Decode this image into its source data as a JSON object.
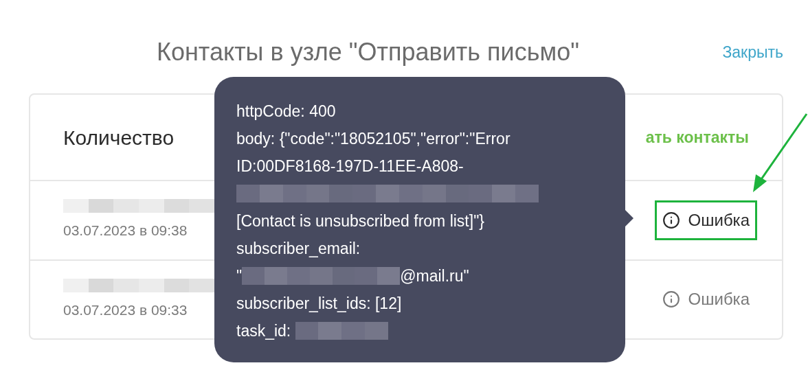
{
  "title": "Контакты в узле \"Отправить письмо\"",
  "close_link": "Закрыть",
  "table": {
    "header": "Количество",
    "action_link": "ать контакты",
    "rows": [
      {
        "name": {
          "kind": "redacted"
        },
        "date": "03.07.2023 в 09:38",
        "status": "Ошибка",
        "annotated": true
      },
      {
        "name": {
          "kind": "redacted"
        },
        "date": "03.07.2023 в 09:33",
        "status": "Ошибка",
        "annotated": false
      }
    ]
  },
  "tooltip": {
    "lines": [
      [
        {
          "kind": "text",
          "text": "httpCode: 400"
        }
      ],
      [
        {
          "kind": "text",
          "text": "body: {\"code\":\"18052105\",\"error\":\"Error"
        }
      ],
      [
        {
          "kind": "text",
          "text": "ID:00DF8168-197D-11EE-A808-"
        }
      ],
      [
        {
          "kind": "redacted"
        }
      ],
      [
        {
          "kind": "text",
          "text": "[Contact is unsubscribed from list]\"}"
        }
      ],
      [
        {
          "kind": "text",
          "text": "subscriber_email:"
        }
      ],
      [
        {
          "kind": "text",
          "text": "\""
        },
        {
          "kind": "redacted"
        },
        {
          "kind": "text",
          "text": "@mail.ru\""
        }
      ],
      [
        {
          "kind": "text",
          "text": "subscriber_list_ids: [12]"
        }
      ],
      [
        {
          "kind": "text",
          "text": "task_id: "
        },
        {
          "kind": "redacted"
        }
      ]
    ]
  }
}
